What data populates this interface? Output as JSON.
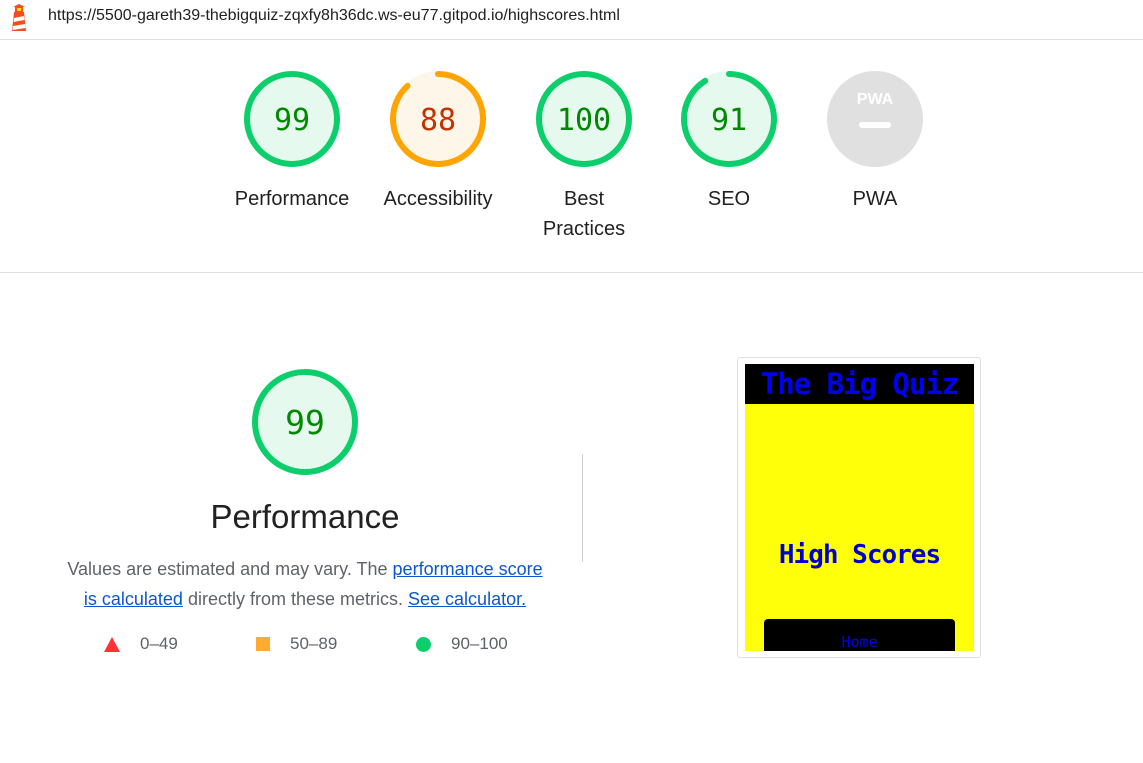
{
  "browser": {
    "url": "https://5500-gareth39-thebigquiz-zqxfy8h36dc.ws-eu77.gitpod.io/highscores.html",
    "logo_icon": "lighthouse-icon"
  },
  "summary": {
    "gauges": [
      {
        "score": "99",
        "label": "Performance",
        "status": "pass",
        "fraction": 0.99
      },
      {
        "score": "88",
        "label": "Accessibility",
        "status": "average",
        "fraction": 0.88
      },
      {
        "score": "100",
        "label": "Best Practices",
        "status": "pass",
        "fraction": 1.0
      },
      {
        "score": "91",
        "label": "SEO",
        "status": "pass",
        "fraction": 0.91
      },
      {
        "score": "PWA",
        "label": "PWA",
        "status": "na",
        "fraction": 0
      }
    ]
  },
  "performance": {
    "score": "99",
    "fraction": 0.99,
    "title": "Performance",
    "desc_prefix": "Values are estimated and may vary. The ",
    "link_score": "performance score is calculated",
    "desc_middle": " directly from these metrics. ",
    "link_calc": "See calculator.",
    "legend": [
      {
        "icon": "triangle-icon",
        "range": "0–49",
        "color": "#ff3333"
      },
      {
        "icon": "square-icon",
        "range": "50–89",
        "color": "#ffaa33"
      },
      {
        "icon": "circle-icon",
        "range": "90–100",
        "color": "#0cce6b"
      }
    ]
  },
  "page_screenshot": {
    "site_title": "The Big Quiz",
    "heading": "High Scores",
    "button": "Home"
  },
  "colors": {
    "pass": "#0cce6b",
    "pass_text": "#008800",
    "pass_bg": "#e6f9ee",
    "average": "#ffa400",
    "average_text": "#c33300",
    "average_bg": "#fff6ea",
    "na": "#e0e0e0"
  }
}
